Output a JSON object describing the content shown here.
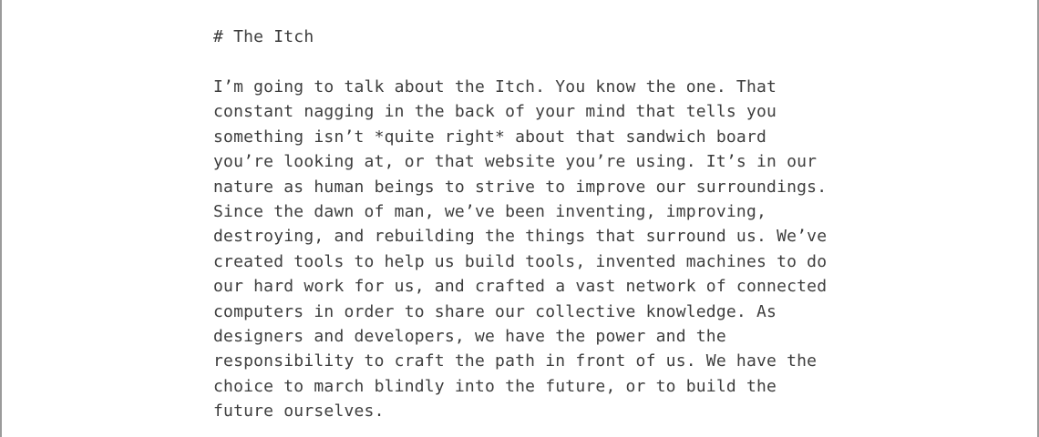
{
  "document": {
    "heading": "# The Itch",
    "lines": [
      "I’m going to talk about the Itch. You know the one. That",
      "constant nagging in the back of your mind that tells you",
      "something isn’t *quite right* about that sandwich board",
      "you’re looking at, or that website you’re using. It’s in our",
      "nature as human beings to strive to improve our surroundings.",
      "Since the dawn of man, we’ve been inventing, improving,",
      "destroying, and rebuilding the things that surround us. We’ve",
      "created tools to help us build tools, invented machines to do",
      "our hard work for us, and crafted a vast network of connected",
      "computers in order to share our collective knowledge. As",
      "designers and developers, we have the power and the",
      "responsibility to craft the path in front of us. We have the",
      "choice to march blindly into the future, or to build the",
      "future ourselves."
    ]
  }
}
